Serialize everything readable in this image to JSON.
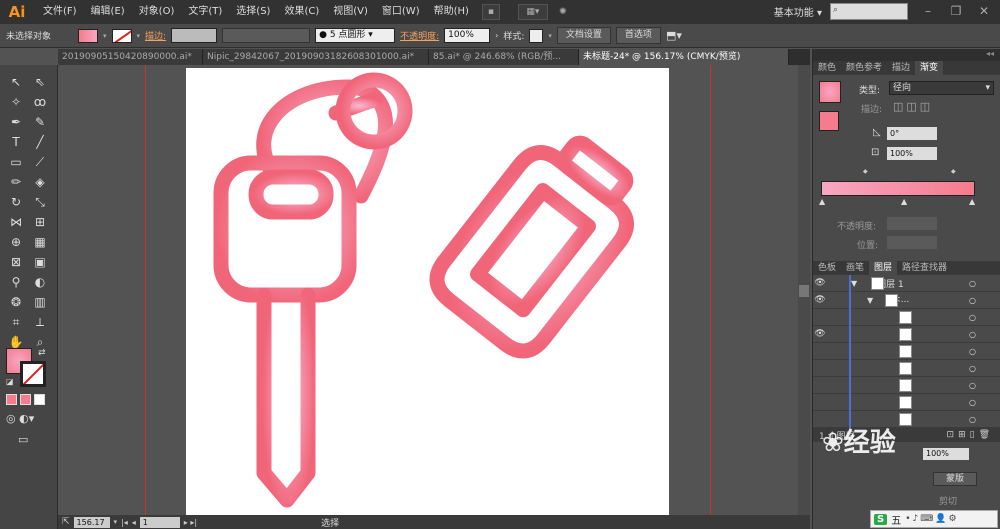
{
  "app": {
    "logo_text": "Ai"
  },
  "menu": [
    "文件(F)",
    "编辑(E)",
    "对象(O)",
    "文字(T)",
    "选择(S)",
    "效果(C)",
    "视图(V)",
    "窗口(W)",
    "帮助(H)"
  ],
  "workspace": "基本功能",
  "control_bar": {
    "selection_status": "未选择对象",
    "stroke_label": "描边:",
    "brush_label": "5 点圆形",
    "opacity_label": "不透明度:",
    "opacity_value": "100%",
    "style_label": "样式:",
    "doc_setup_button": "文档设置",
    "prefs_button": "首选项"
  },
  "tabs": [
    {
      "label": "20190905150420890000.ai*",
      "active": false
    },
    {
      "label": "Nipic_29842067_20190903182608301000.ai*",
      "active": false
    },
    {
      "label": "85.ai* @ 246.68% (RGB/预...",
      "active": false
    },
    {
      "label": "未标题-24* @ 156.17% (CMYK/预览)",
      "active": true
    }
  ],
  "status_bar": {
    "zoom": "156.17",
    "page": "1",
    "tool_status": "选择"
  },
  "gradient_panel": {
    "tabs": [
      "颜色",
      "颜色参考",
      "描边",
      "渐变"
    ],
    "active_tab": "渐变",
    "type_label": "类型:",
    "type_value": "径向",
    "stroke_label": "描边:",
    "angle_value": "0°",
    "aspect_value": "100%",
    "opacity_label": "不透明度:",
    "position_label": "位置:"
  },
  "layers_panel": {
    "tabs": [
      "色板",
      "画笔",
      "图层",
      "路径查找器"
    ],
    "active_tab": "图层",
    "layer_name": "图层 1",
    "group_name": "<...",
    "footer_count": "1 个图层"
  },
  "bottom_panel": {
    "opacity_value": "100%",
    "mask_button": "蒙版",
    "clip_label": "剪切"
  },
  "watermark": "经验",
  "ime": {
    "label": "五"
  },
  "colors": {
    "accent": "#f7941d",
    "gradient_start": "#f47c8c",
    "gradient_end": "#f9a6c3",
    "guide": "#cc3333"
  }
}
